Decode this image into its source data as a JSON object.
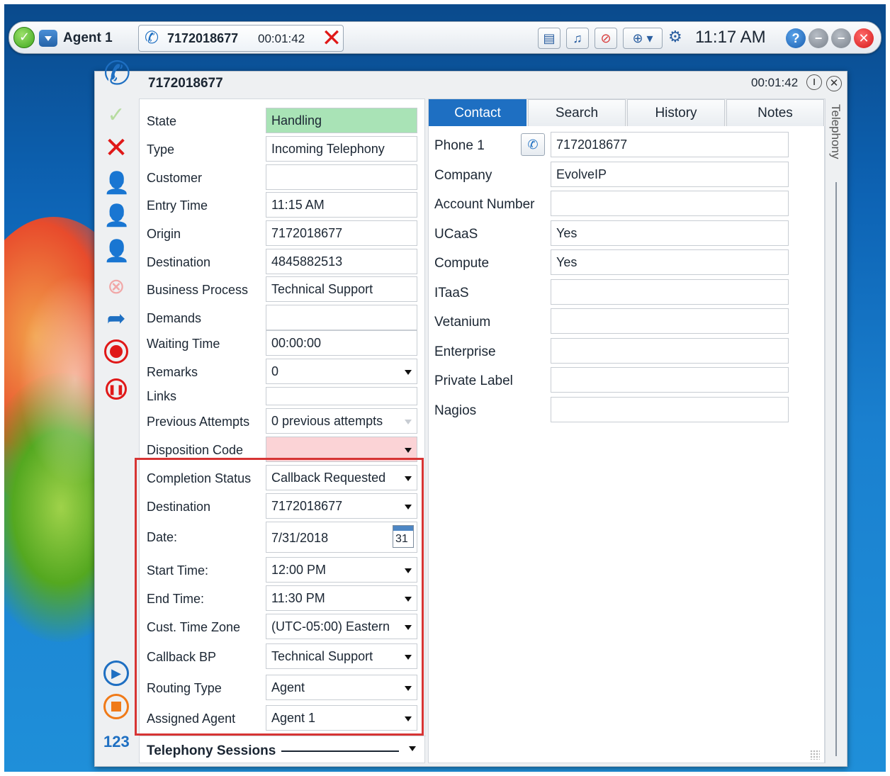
{
  "topbar": {
    "agent_name": "Agent 1",
    "call_number": "7172018677",
    "call_timer": "00:01:42",
    "clock": "11:17 AM",
    "help_label": "?",
    "icons": [
      "status-available-icon",
      "status-dropdown-icon",
      "phone-call-icon",
      "hangup-icon",
      "contact-card-icon",
      "bell-icon",
      "mute-icon",
      "add-call-icon",
      "gear-icon",
      "help-icon",
      "minimize-icon",
      "maximize-icon",
      "close-icon"
    ]
  },
  "window": {
    "title": "7172018677",
    "timer": "00:01:42"
  },
  "form": {
    "fields": [
      {
        "label": "State",
        "value": "Handling"
      },
      {
        "label": "Type",
        "value": "Incoming Telephony"
      },
      {
        "label": "Customer",
        "value": ""
      },
      {
        "label": "Entry Time",
        "value": "11:15 AM"
      },
      {
        "label": "Origin",
        "value": "7172018677"
      },
      {
        "label": "Destination",
        "value": "4845882513"
      },
      {
        "label": "Business Process",
        "value": "Technical Support"
      },
      {
        "label": "Demands",
        "value": ""
      },
      {
        "label": "Waiting Time",
        "value": "00:00:00"
      },
      {
        "label": "Remarks",
        "value": "0"
      },
      {
        "label": "Links",
        "value": ""
      },
      {
        "label": "Previous Attempts",
        "value": "0 previous attempts"
      },
      {
        "label": "Disposition Code",
        "value": ""
      }
    ],
    "callback": [
      {
        "label": "Completion Status",
        "value": "Callback Requested"
      },
      {
        "label": "Destination",
        "value": "7172018677"
      },
      {
        "label": "Date:",
        "value": "7/31/2018",
        "calendar_day": "31"
      },
      {
        "label": "Start Time:",
        "value": "12:00 PM"
      },
      {
        "label": "End Time:",
        "value": "11:30 PM"
      },
      {
        "label": "Cust. Time Zone",
        "value": "(UTC-05:00) Eastern"
      },
      {
        "label": "Callback BP",
        "value": "Technical Support"
      },
      {
        "label": "Routing Type",
        "value": "Agent"
      },
      {
        "label": "Assigned Agent",
        "value": "Agent 1"
      }
    ],
    "sessions_label": "Telephony Sessions"
  },
  "sidebar": {
    "counter_label": "123"
  },
  "contact": {
    "tabs": [
      "Contact",
      "Search",
      "History",
      "Notes"
    ],
    "active_tab": "Contact",
    "fields": [
      {
        "label": "Phone 1",
        "value": "7172018677"
      },
      {
        "label": "Company",
        "value": "EvolveIP"
      },
      {
        "label": "Account Number",
        "value": ""
      },
      {
        "label": "UCaaS",
        "value": "Yes"
      },
      {
        "label": "Compute",
        "value": "Yes"
      },
      {
        "label": "ITaaS",
        "value": ""
      },
      {
        "label": "Vetanium",
        "value": ""
      },
      {
        "label": "Enterprise",
        "value": ""
      },
      {
        "label": "Private Label",
        "value": ""
      },
      {
        "label": "Nagios",
        "value": ""
      }
    ]
  },
  "side_tab": {
    "label": "Telephony"
  },
  "colors": {
    "accent": "#1e6fc2",
    "state_handling": "#a9e3b6",
    "disposition_required": "#fbd3d6",
    "highlight_border": "#d73434",
    "hangup": "#e01818"
  }
}
